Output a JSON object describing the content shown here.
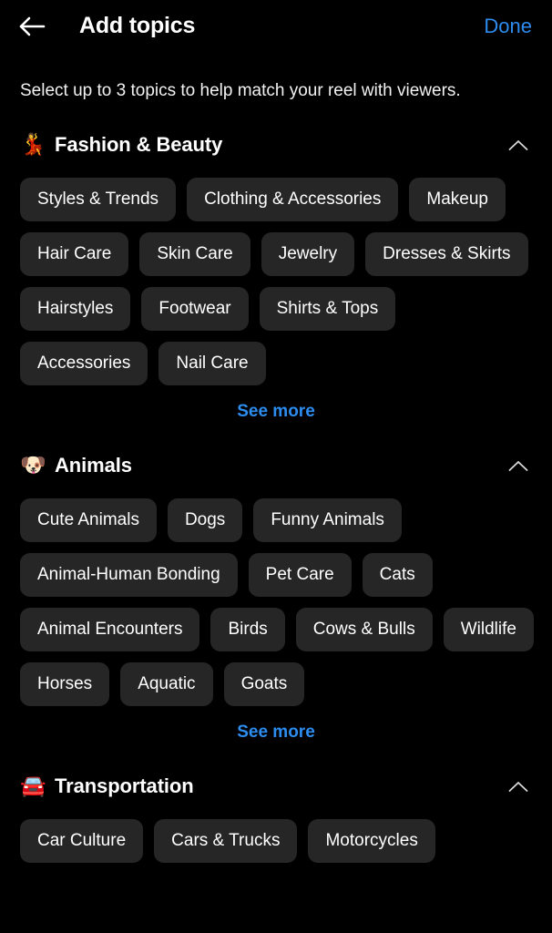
{
  "header": {
    "back_icon": "arrow-left-icon",
    "title": "Add topics",
    "done_label": "Done"
  },
  "subtitle": "Select up to 3 topics to help match your reel with viewers.",
  "sections": [
    {
      "id": "fashion-beauty",
      "emoji": "💃",
      "emoji_name": "dancer-emoji",
      "title": "Fashion & Beauty",
      "collapse_icon": "chevron-up-icon",
      "see_more_label": "See more",
      "chips": [
        "Styles & Trends",
        "Clothing & Accessories",
        "Makeup",
        "Hair Care",
        "Skin Care",
        "Jewelry",
        "Dresses & Skirts",
        "Hairstyles",
        "Footwear",
        "Shirts & Tops",
        "Accessories",
        "Nail Care"
      ]
    },
    {
      "id": "animals",
      "emoji": "🐶",
      "emoji_name": "dog-face-emoji",
      "title": "Animals",
      "collapse_icon": "chevron-up-icon",
      "see_more_label": "See more",
      "chips": [
        "Cute Animals",
        "Dogs",
        "Funny Animals",
        "Animal-Human Bonding",
        "Pet Care",
        "Cats",
        "Animal Encounters",
        "Birds",
        "Cows & Bulls",
        "Wildlife",
        "Horses",
        "Aquatic",
        "Goats"
      ]
    },
    {
      "id": "transportation",
      "emoji": "🚘",
      "emoji_name": "car-emoji",
      "title": "Transportation",
      "collapse_icon": "chevron-up-icon",
      "see_more_label": "",
      "chips": [
        "Car Culture",
        "Cars & Trucks",
        "Motorcycles"
      ]
    }
  ],
  "colors": {
    "background": "#000000",
    "chip_background": "#262626",
    "accent_blue": "#2d8cef",
    "text_primary": "#ffffff"
  }
}
